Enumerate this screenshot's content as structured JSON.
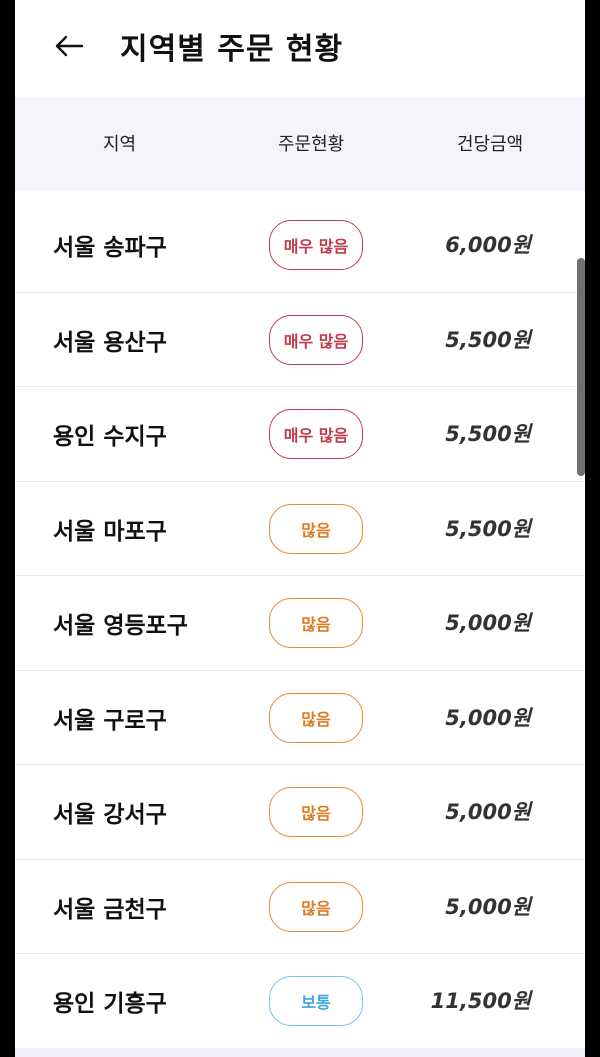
{
  "header": {
    "back_icon": "arrow-left-icon",
    "title": "지역별 주문 현황"
  },
  "table": {
    "columns": [
      "지역",
      "주문현황",
      "건당금액"
    ],
    "rows": [
      {
        "region": "서울 송파구",
        "status": "매우 많음",
        "level": "very",
        "price": "6,000원"
      },
      {
        "region": "서울 용산구",
        "status": "매우 많음",
        "level": "very",
        "price": "5,500원"
      },
      {
        "region": "용인 수지구",
        "status": "매우 많음",
        "level": "very",
        "price": "5,500원"
      },
      {
        "region": "서울 마포구",
        "status": "많음",
        "level": "many",
        "price": "5,500원"
      },
      {
        "region": "서울 영등포구",
        "status": "많음",
        "level": "many",
        "price": "5,000원"
      },
      {
        "region": "서울 구로구",
        "status": "많음",
        "level": "many",
        "price": "5,000원"
      },
      {
        "region": "서울 강서구",
        "status": "많음",
        "level": "many",
        "price": "5,000원"
      },
      {
        "region": "서울 금천구",
        "status": "많음",
        "level": "many",
        "price": "5,000원"
      },
      {
        "region": "용인 기흥구",
        "status": "보통",
        "level": "normal",
        "price": "11,500원"
      }
    ]
  },
  "colors": {
    "very": "#c43a48",
    "many": "#e07b22",
    "normal": "#3aa8dc"
  }
}
